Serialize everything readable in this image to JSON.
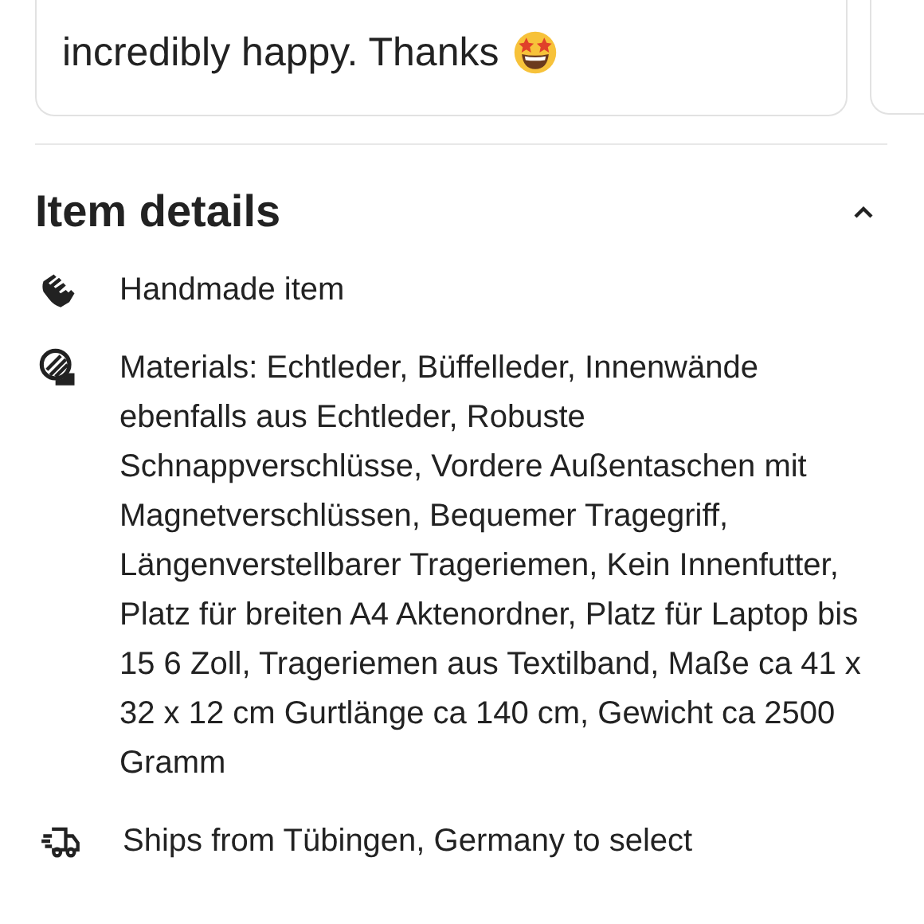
{
  "review": {
    "text": "incredibly happy. Thanks"
  },
  "section": {
    "title": "Item details",
    "expanded": true
  },
  "details": [
    {
      "kind": "handmade",
      "text": "Handmade item"
    },
    {
      "kind": "materials",
      "text": "Materials: Echtleder, Büffelleder, Innenwände ebenfalls aus Echtleder, Robuste Schnappverschlüsse, Vordere Außentaschen mit Magnetverschlüssen, Bequemer Tragegriff, Längenverstellbarer Trageriemen, Kein Innenfutter, Platz für breiten A4 Aktenordner, Platz für Laptop bis 15 6 Zoll, Trageriemen aus Textilband, Maße ca 41 x 32 x 12 cm Gurtlänge ca 140 cm, Gewicht ca 2500 Gramm"
    },
    {
      "kind": "shipping",
      "text": "Ships from Tübingen, Germany to select"
    }
  ]
}
